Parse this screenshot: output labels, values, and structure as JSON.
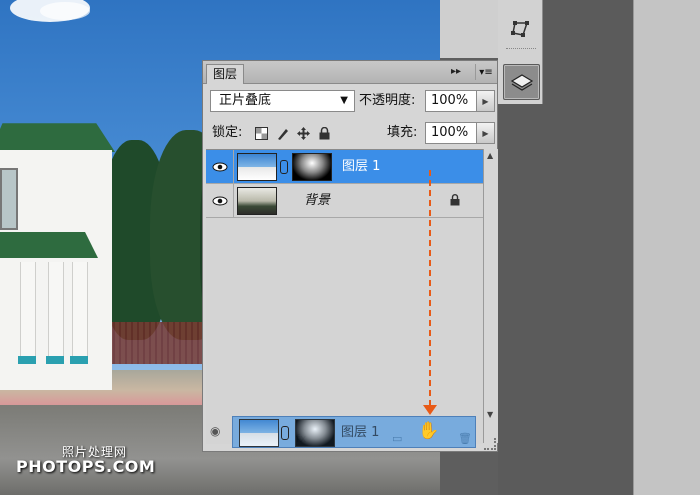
{
  "panel": {
    "tab_label": "图层",
    "head_collapse": "▸▸",
    "head_menu": "▾≡",
    "blend_mode": "正片叠底",
    "opacity_label": "不透明度:",
    "opacity_value": "100%",
    "lock_label": "锁定:",
    "fill_label": "填充:",
    "fill_value": "100%"
  },
  "layers": [
    {
      "name": "图层 1",
      "selected": true,
      "has_mask": true,
      "visible": true
    },
    {
      "name": "背景",
      "selected": false,
      "locked": true,
      "visible": true
    }
  ],
  "drag_preview": {
    "name": "图层 1"
  },
  "watermark": {
    "line1": "照片处理网",
    "line2": "PHOTOPS.COM"
  },
  "colors": {
    "selection": "#3b8ee8",
    "drag_arrow": "#e85a17"
  },
  "icons": [
    "eye-icon",
    "chain-icon",
    "lock-icon",
    "layers-icon",
    "transform-icon",
    "hand-cursor-icon",
    "trash-icon",
    "folder-icon",
    "fx-icon"
  ]
}
